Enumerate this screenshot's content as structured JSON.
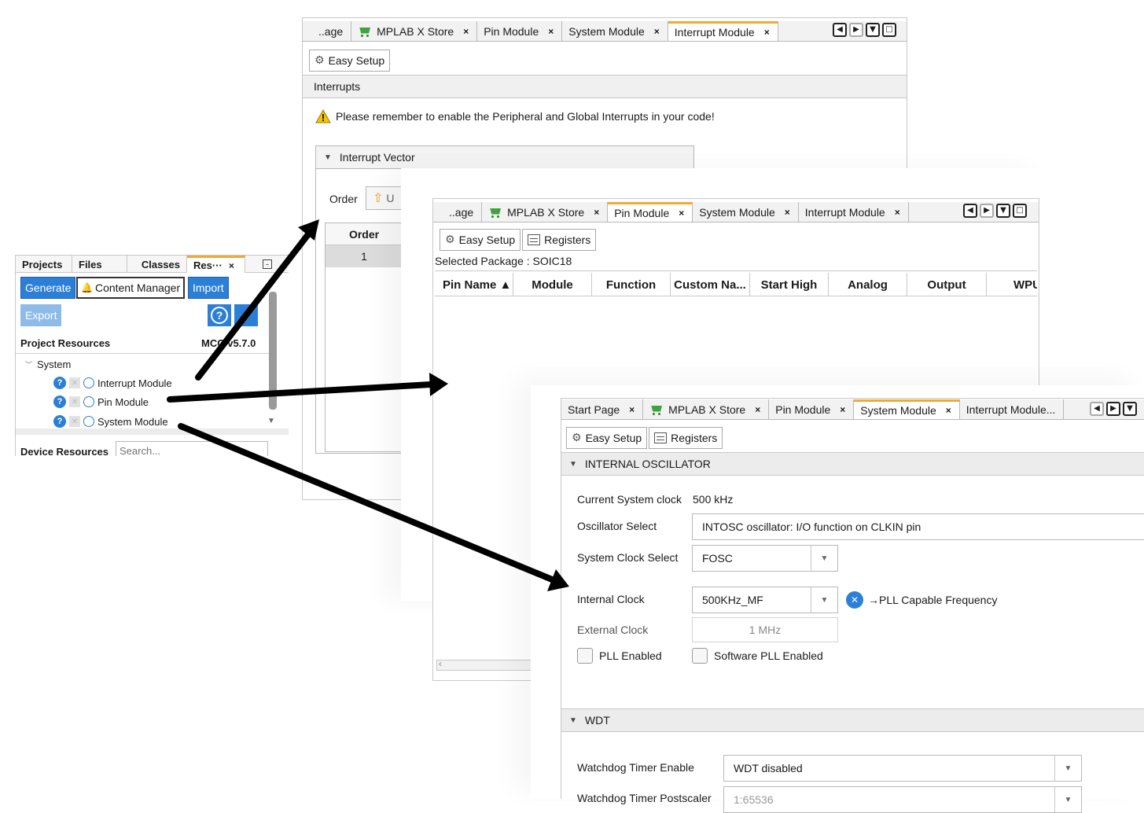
{
  "interrupt_window": {
    "tabs": [
      {
        "label": "..age",
        "close": ""
      },
      {
        "label": "MPLAB X Store",
        "close": "×"
      },
      {
        "label": "Pin Module",
        "close": "×"
      },
      {
        "label": "System Module",
        "close": "×"
      },
      {
        "label": "Interrupt Module",
        "close": "×"
      }
    ],
    "active_tab": "Interrupt Module",
    "easy_setup": "Easy Setup",
    "section_title": "Interrupts",
    "warning": "Please remember to enable the Peripheral and Global Interrupts in your code!",
    "vector_header": "Interrupt Vector",
    "order_label": "Order",
    "up_button": "U",
    "table_header": "Order",
    "table_row_1": "1"
  },
  "pin_window": {
    "tabs": [
      {
        "label": "..age",
        "close": ""
      },
      {
        "label": "MPLAB X Store",
        "close": "×"
      },
      {
        "label": "Pin Module",
        "close": "×"
      },
      {
        "label": "System Module",
        "close": "×"
      },
      {
        "label": "Interrupt Module",
        "close": "×"
      }
    ],
    "active_tab": "Pin Module",
    "easy_setup": "Easy Setup",
    "registers": "Registers",
    "package": "Selected Package : SOIC18",
    "columns": [
      "Pin Name ▲",
      "Module",
      "Function",
      "Custom Na...",
      "Start High",
      "Analog",
      "Output",
      "WPU"
    ]
  },
  "system_window": {
    "tabs": [
      {
        "label": "Start Page",
        "close": "×"
      },
      {
        "label": "MPLAB X Store",
        "close": "×"
      },
      {
        "label": "Pin Module",
        "close": "×"
      },
      {
        "label": "System Module",
        "close": "×"
      },
      {
        "label": "Interrupt Module...",
        "close": ""
      }
    ],
    "active_tab": "System Module",
    "easy_setup": "Easy Setup",
    "registers": "Registers",
    "osc_section": "INTERNAL OSCILLATOR",
    "current_clock_label": "Current System clock",
    "current_clock_value": "500 kHz",
    "osc_select_label": "Oscillator Select",
    "osc_select_value": "INTOSC oscillator: I/O function on CLKIN pin",
    "sys_clock_label": "System Clock Select",
    "sys_clock_value": "FOSC",
    "internal_clock_label": "Internal Clock",
    "internal_clock_value": "500KHz_MF",
    "pll_capable": "→PLL Capable Frequency",
    "external_clock_label": "External Clock",
    "external_clock_value": "1 MHz",
    "pll_enabled": "PLL Enabled",
    "sw_pll_enabled": "Software PLL Enabled",
    "wdt_section": "WDT",
    "wdt_enable_label": "Watchdog Timer Enable",
    "wdt_enable_value": "WDT disabled",
    "wdt_postscaler_label": "Watchdog Timer Postscaler",
    "wdt_postscaler_value": "1:65536"
  },
  "left_dock": {
    "tabs": [
      "Projects",
      "Files",
      "Classes",
      "Res···"
    ],
    "tab_close": "×",
    "generate": "Generate",
    "content_manager": "Content Manager",
    "import": "Import",
    "export": "Export",
    "project_resources": "Project Resources",
    "mcc_version": "MCC v5.7.0",
    "tree_root": "System",
    "tree_items": [
      "Interrupt Module",
      "Pin Module",
      "System Module"
    ],
    "device_resources": "Device Resources",
    "search_placeholder": "Search..."
  },
  "colors": {
    "accent_tab": "#f0a838",
    "button_blue": "#2c7fd6",
    "arrow": "#000000"
  }
}
